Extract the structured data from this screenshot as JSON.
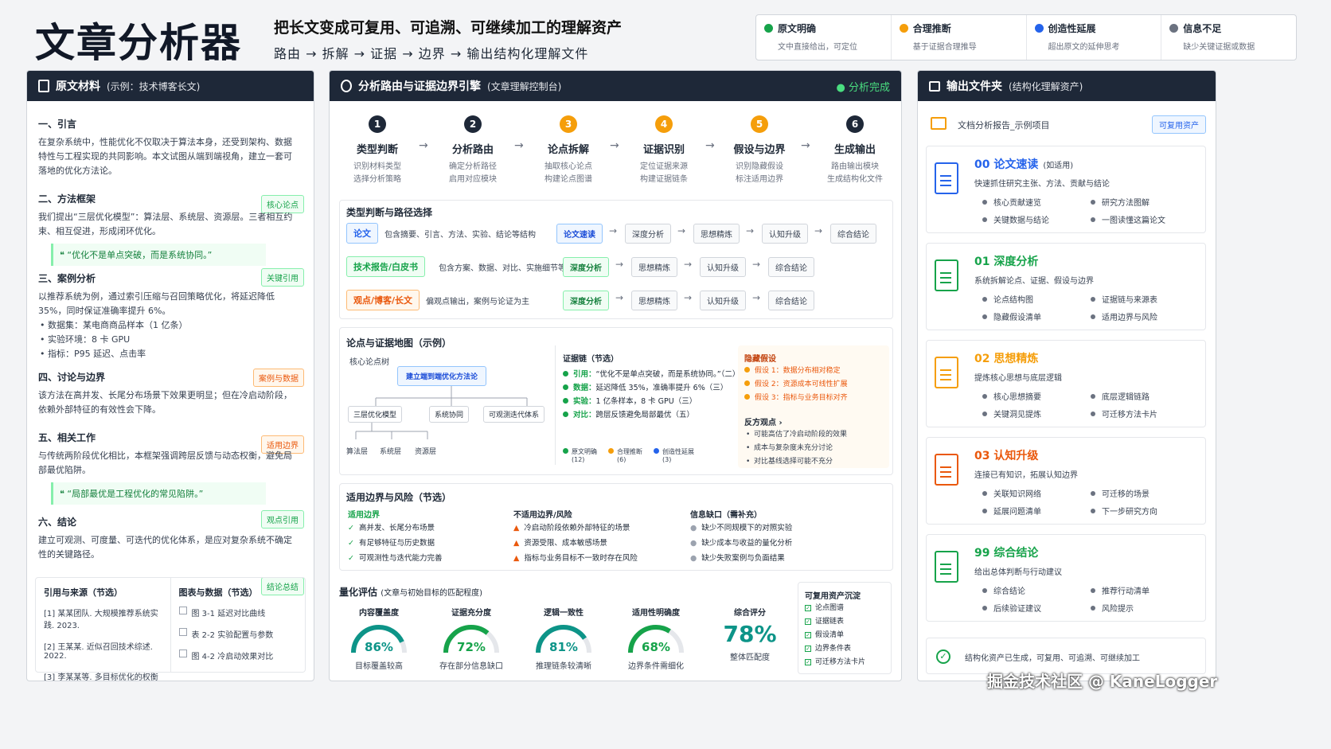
{
  "header": {
    "title": "文章分析器",
    "subtitle": "把长文变成可复用、可追溯、可继续加工的理解资产",
    "flow": "路由 → 拆解 → 证据 → 边界 → 输出结构化理解文件"
  },
  "legend": [
    {
      "title": "原文明确",
      "desc": "文中直接给出，可定位",
      "color": "#16a34a"
    },
    {
      "title": "合理推断",
      "desc": "基于证据合理推导",
      "color": "#f59e0b"
    },
    {
      "title": "创造性延展",
      "desc": "超出原文的延伸思考",
      "color": "#2563eb"
    },
    {
      "title": "信息不足",
      "desc": "缺少关键证据或数据",
      "color": "#6b7280"
    }
  ],
  "left": {
    "title": "原文材料",
    "subtitle": "(示例：技术博客长文)",
    "s1": {
      "h": "一、引言",
      "p": "在复杂系统中，性能优化不仅取决于算法本身，还受到架构、数据特性与工程实现的共同影响。本文试图从端到端视角，建立一套可落地的优化方法论。",
      "tag": "核心论点"
    },
    "s2": {
      "h": "二、方法框架",
      "p": "我们提出“三层优化模型”：算法层、系统层、资源层。三者相互约束、相互促进，形成闭环优化。",
      "quote": "❝ “优化不是单点突破，而是系统协同。”",
      "tag": "关键引用"
    },
    "s3": {
      "h": "三、案例分析",
      "p": "以推荐系统为例，通过索引压缩与召回策略优化，将延迟降低 35%，同时保证准确率提升 6%。",
      "b1": "数据集：某电商商品样本（1 亿条）",
      "b2": "实验环境：8 卡 GPU",
      "b3": "指标：P95 延迟、点击率",
      "tag": "案例与数据"
    },
    "s4": {
      "h": "四、讨论与边界",
      "p": "该方法在高并发、长尾分布场景下效果更明显；但在冷启动阶段，依赖外部特征的有效性会下降。",
      "tag": "适用边界"
    },
    "s5": {
      "h": "五、相关工作",
      "p": "与传统两阶段优化相比，本框架强调跨层反馈与动态权衡，避免局部最优陷阱。",
      "quote": "❝ “局部最优是工程优化的常见陷阱。”",
      "tag": "观点引用"
    },
    "s6": {
      "h": "六、结论",
      "p": "建立可观测、可度量、可迭代的优化体系，是应对复杂系统不确定性的关键路径。",
      "tag": "结论总结"
    },
    "refs": {
      "h": "引用与来源（节选）",
      "items": [
        "[1] 某某团队. 大规模推荐系统实践. 2023.",
        "[2] 王某某. 近似召回技术综述. 2022.",
        "[3] 李某某等. 多目标优化的权衡方法. 2021."
      ]
    },
    "figs": {
      "h": "图表与数据（节选）",
      "items": [
        "图 3-1 延迟对比曲线",
        "表 2-2 实验配置与参数",
        "图 4-2 冷启动效果对比"
      ]
    }
  },
  "mid": {
    "title": "分析路由与证据边界引擎",
    "subtitle": "(文章理解控制台)",
    "status": "● 分析完成",
    "steps": [
      {
        "n": "1",
        "t": "类型判断",
        "d1": "识别材料类型",
        "d2": "选择分析策略",
        "c": "#1e2838"
      },
      {
        "n": "2",
        "t": "分析路由",
        "d1": "确定分析路径",
        "d2": "启用对应模块",
        "c": "#1e2838"
      },
      {
        "n": "3",
        "t": "论点拆解",
        "d1": "抽取核心论点",
        "d2": "构建论点图谱",
        "c": "#f59e0b"
      },
      {
        "n": "4",
        "t": "证据识别",
        "d1": "定位证据来源",
        "d2": "构建证据链条",
        "c": "#f59e0b"
      },
      {
        "n": "5",
        "t": "假设与边界",
        "d1": "识别隐藏假设",
        "d2": "标注适用边界",
        "c": "#f59e0b"
      },
      {
        "n": "6",
        "t": "生成输出",
        "d1": "路由输出模块",
        "d2": "生成结构化文件",
        "c": "#1e2838"
      }
    ],
    "routing": {
      "h": "类型判断与路径选择",
      "rows": [
        {
          "tag": "论文",
          "desc": "包含摘要、引言、方法、实验、结论等结构",
          "chips": [
            "论文速读",
            "深度分析",
            "思想精炼",
            "认知升级",
            "综合结论"
          ]
        },
        {
          "tag": "技术报告/白皮书",
          "desc": "包含方案、数据、对比、实施细节等",
          "chips": [
            "深度分析",
            "思想精炼",
            "认知升级",
            "综合结论"
          ]
        },
        {
          "tag": "观点/博客/长文",
          "desc": "偏观点输出，案例与论证为主",
          "chips": [
            "深度分析",
            "思想精炼",
            "认知升级",
            "综合结论"
          ]
        }
      ]
    },
    "map": {
      "h": "论点与证据地图（示例）",
      "tree": "核心论点树",
      "root": "建立端到端优化方法论",
      "l2": [
        "三层优化模型",
        "系统协同",
        "可观测迭代体系"
      ],
      "l3": [
        "算法层",
        "系统层",
        "资源层"
      ],
      "ev_h": "证据链（节选）",
      "ev": [
        {
          "k": "引用：",
          "v": "“优化不是单点突破，而是系统协同。”（二）"
        },
        {
          "k": "数据：",
          "v": "延迟降低 35%，准确率提升 6%（三）"
        },
        {
          "k": "实验：",
          "v": "1 亿条样本，8 卡 GPU（三）"
        },
        {
          "k": "对比：",
          "v": "跨层反馈避免局部最优（五）"
        }
      ],
      "cnt": [
        {
          "l": "原文明确",
          "n": "(12)"
        },
        {
          "l": "合理推断",
          "n": "(6)"
        },
        {
          "l": "创造性延展",
          "n": "(3)"
        }
      ],
      "hid_h": "隐藏假设",
      "hid": [
        "假设 1：数据分布相对稳定",
        "假设 2：资源成本可线性扩展",
        "假设 3：指标与业务目标对齐"
      ],
      "con_h": "反方观点 ›",
      "con": [
        "可能高估了冷启动阶段的效果",
        "成本与复杂度未充分讨论",
        "对比基线选择可能不充分"
      ]
    },
    "boundary": {
      "h": "适用边界与风险（节选）",
      "ok_h": "适用边界",
      "ok": [
        "高并发、长尾分布场景",
        "有足够特征与历史数据",
        "可观测性与迭代能力完善"
      ],
      "no_h": "不适用边界/风险",
      "no": [
        "冷启动阶段依赖外部特征的场景",
        "资源受限、成本敏感场景",
        "指标与业务目标不一致时存在风险"
      ],
      "gap_h": "信息缺口（需补充）",
      "gap": [
        "缺少不同规模下的对照实验",
        "缺少成本与收益的量化分析",
        "缺少失败案例与负面结果"
      ]
    },
    "eval": {
      "h": "量化评估",
      "hs": "(文章与初始目标的匹配程度)",
      "g": [
        {
          "l": "内容覆盖度",
          "v": "86%",
          "p": 0.86,
          "s": "目标覆盖较高"
        },
        {
          "l": "证据充分度",
          "v": "72%",
          "p": 0.72,
          "s": "存在部分信息缺口"
        },
        {
          "l": "逻辑一致性",
          "v": "81%",
          "p": 0.81,
          "s": "推理链条较清晰"
        },
        {
          "l": "适用性明确度",
          "v": "68%",
          "p": 0.68,
          "s": "边界条件需细化"
        }
      ],
      "total": {
        "l": "综合评分",
        "v": "78%",
        "s": "整体匹配度"
      },
      "asset_h": "可复用资产沉淀",
      "assets": [
        "论点图谱",
        "证据链表",
        "假设清单",
        "边界条件表",
        "可迁移方法卡片"
      ]
    }
  },
  "right": {
    "title": "输出文件夹",
    "subtitle": "(结构化理解资产)",
    "report": "文档分析报告_示例项目",
    "reuse": "可复用资产",
    "cards": [
      {
        "t": "00  论文速读",
        "tp": "(如适用)",
        "d": "快速抓住研究主张、方法、贡献与结论",
        "i": [
          "核心贡献速览",
          "研究方法图解",
          "关键数据与结论",
          "一图读懂这篇论文"
        ],
        "c": "#2563eb"
      },
      {
        "t": "01  深度分析",
        "tp": "",
        "d": "系统拆解论点、证据、假设与边界",
        "i": [
          "论点结构图",
          "证据链与来源表",
          "隐藏假设清单",
          "适用边界与风险"
        ],
        "c": "#16a34a"
      },
      {
        "t": "02  思想精炼",
        "tp": "",
        "d": "提炼核心思想与底层逻辑",
        "i": [
          "核心思想摘要",
          "底层逻辑链路",
          "关键洞见提炼",
          "可迁移方法卡片"
        ],
        "c": "#f59e0b"
      },
      {
        "t": "03  认知升级",
        "tp": "",
        "d": "连接已有知识，拓展认知边界",
        "i": [
          "关联知识网络",
          "可迁移的场景",
          "延展问题清单",
          "下一步研究方向"
        ],
        "c": "#ea580c"
      },
      {
        "t": "99  综合结论",
        "tp": "",
        "d": "给出总体判断与行动建议",
        "i": [
          "综合结论",
          "推荐行动清单",
          "后续验证建议",
          "风险提示"
        ],
        "c": "#16a34a"
      }
    ],
    "footer": "结构化资产已生成，可复用、可追溯、可继续加工"
  },
  "watermark": "掘金技术社区 @ KaneLogger"
}
